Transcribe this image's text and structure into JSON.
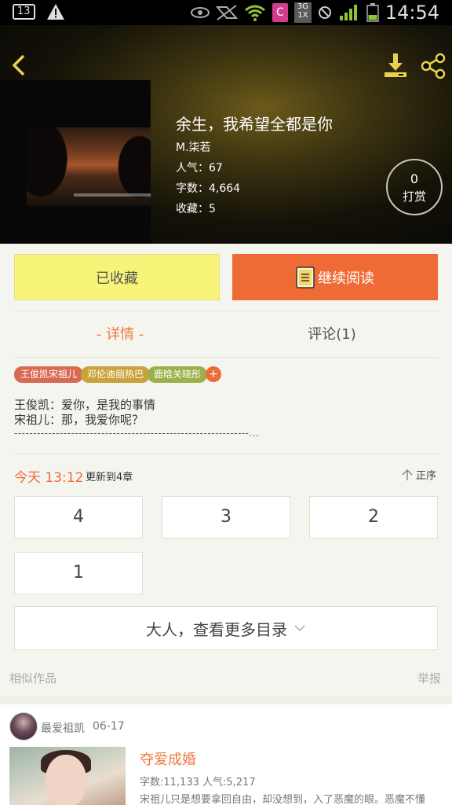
{
  "status_bar": {
    "notification_count": "13",
    "carrier_badge": "C",
    "net_badge_top": "3G",
    "net_badge_bottom": "1X",
    "time": "14:54"
  },
  "header": {
    "title": "余生，我希望全都是你",
    "author": "M.柒若",
    "popularity": "人气：67",
    "word_count": "字数：4,664",
    "favorites": "收藏：5",
    "tip_count": "0",
    "tip_label": "打赏"
  },
  "actions": {
    "favorited_label": "已收藏",
    "continue_label": "继续阅读"
  },
  "tabs": {
    "detail": "- 详情 -",
    "comments": "评论(1)"
  },
  "tags": [
    {
      "label": "王俊凯宋祖儿",
      "color": "#d86a52"
    },
    {
      "label": "邓伦迪丽热巴",
      "color": "#c9a23a"
    },
    {
      "label": "鹿晗关晓彤",
      "color": "#9bb04a"
    }
  ],
  "tag_add": "+",
  "intro": {
    "line1": "王俊凯：爱你，是我的事情",
    "line2": "宋祖儿：那，我爱你呢？",
    "dashes": "--------------------------------------------------------------..."
  },
  "updates": {
    "time": "今天 13:12",
    "text": "更新到4章",
    "sort_label": "正序"
  },
  "chapters": [
    "4",
    "3",
    "2",
    "1"
  ],
  "more_catalog": "大人，查看更多目录",
  "similar_label": "相似作品",
  "report_label": "举报",
  "card": {
    "user": "最爱祖凯",
    "date": "06-17",
    "title": "夺爱成婚",
    "stats": "字数:11,133   人气:5,217",
    "desc": "宋祖儿只是想要拿回自由，却没想到，入了恶魔的眼。恶魔不懂"
  }
}
